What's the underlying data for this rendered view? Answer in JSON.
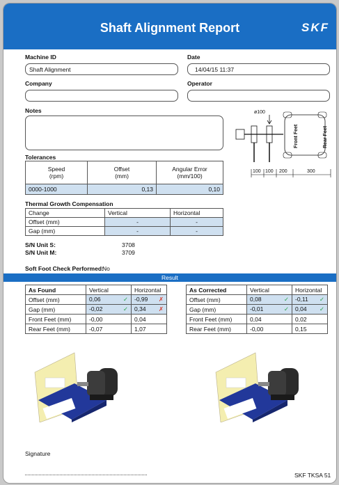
{
  "header": {
    "title": "Shaft Alignment Report",
    "logo": "SKF"
  },
  "fields": {
    "machine_id_label": "Machine ID",
    "machine_id_value": "Shaft Alignment",
    "date_label": "Date",
    "date_value": "14/04/15 11:37",
    "company_label": "Company",
    "company_value": "",
    "operator_label": "Operator",
    "operator_value": "",
    "notes_label": "Notes",
    "notes_value": ""
  },
  "diagram": {
    "diameter": "ø100",
    "front_feet": "Front Feet",
    "rear_feet": "Rear Feet",
    "dims": [
      "100",
      "100",
      "200",
      "300"
    ]
  },
  "tolerances": {
    "title": "Tolerances",
    "headers": [
      "Speed\n(rpm)",
      "Offset\n(mm)",
      "Angular Error\n(mm/100)"
    ],
    "row": [
      "0000-1000",
      "0,13",
      "0,10"
    ]
  },
  "thermal": {
    "title": "Thermal Growth Compensation",
    "headers": [
      "Change",
      "Vertical",
      "Horizontal"
    ],
    "rows": [
      [
        "Offset (mm)",
        "-",
        "-"
      ],
      [
        "Gap (mm)",
        "-",
        "-"
      ]
    ]
  },
  "serials": {
    "unit_s_label": "S/N Unit S:",
    "unit_s_value": "3708",
    "unit_m_label": "S/N Unit M:",
    "unit_m_value": "3709"
  },
  "soft_foot": {
    "label": "Soft Foot Check Performed:",
    "value": "No"
  },
  "result_label": "Result",
  "as_found": {
    "headers": [
      "As Found",
      "Vertical",
      "Horizontal"
    ],
    "rows": [
      [
        "Offset (mm)",
        "0,06",
        "-0,99"
      ],
      [
        "Gap (mm)",
        "-0,02",
        "0,34"
      ],
      [
        "Front Feet (mm)",
        "-0,00",
        "0,04"
      ],
      [
        "Rear Feet (mm)",
        "-0,07",
        "1,07"
      ]
    ]
  },
  "as_corrected": {
    "headers": [
      "As Corrected",
      "Vertical",
      "Horizontal"
    ],
    "rows": [
      [
        "Offset (mm)",
        "0,08",
        "-0,11"
      ],
      [
        "Gap (mm)",
        "-0,01",
        "0,04"
      ],
      [
        "Front Feet (mm)",
        "0,04",
        "0,02"
      ],
      [
        "Rear Feet (mm)",
        "-0,00",
        "0,15"
      ]
    ]
  },
  "marks": {
    "check": "✓",
    "cross": "✗"
  },
  "footer": {
    "signature_label": "Signature",
    "model": "SKF TKSA 51"
  },
  "colors": {
    "brand_blue": "#1a6ec4",
    "cell_blue": "#cfe0f0",
    "ok_green": "#29a34a",
    "bad_red": "#d63a2a"
  }
}
